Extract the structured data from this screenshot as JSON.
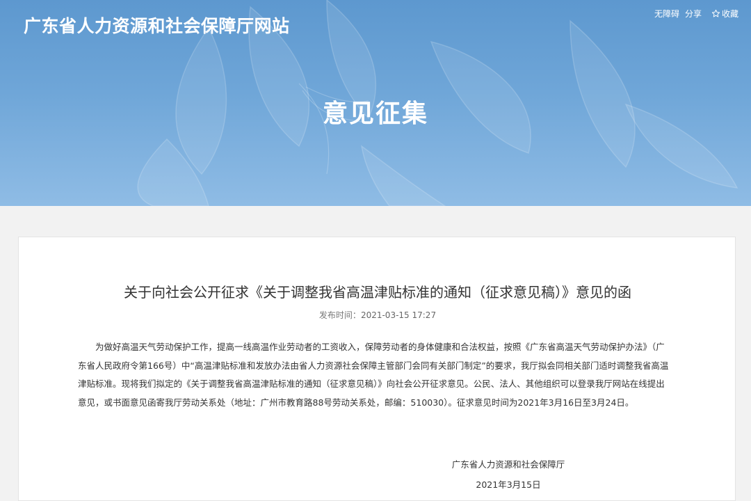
{
  "header": {
    "site_title": "广东省人力资源和社会保障厅网站",
    "toolbar": {
      "accessibility_label": "无障碍",
      "share_label": "分享",
      "favorite_label": "收藏"
    },
    "section_title": "意见征集"
  },
  "article": {
    "title": "关于向社会公开征求《关于调整我省高温津贴标准的通知（征求意见稿）》意见的函",
    "publish_label": "发布时间：",
    "publish_time": "2021-03-15 17:27",
    "body": "为做好高温天气劳动保护工作，提高一线高温作业劳动者的工资收入，保障劳动者的身体健康和合法权益，按照《广东省高温天气劳动保护办法》（广东省人民政府令第166号）中“高温津贴标准和发放办法由省人力资源社会保障主管部门会同有关部门制定”的要求，我厅拟会同相关部门适时调整我省高温津贴标准。现将我们拟定的《关于调整我省高温津贴标准的通知（征求意见稿）》向社会公开征求意见。公民、法人、其他组织可以登录我厅网站在线提出意见，或书面意见函寄我厅劳动关系处（地址：广州市教育路88号劳动关系处，邮编：510030）。征求意见时间为2021年3月16日至3月24日。",
    "signature_org": "广东省人力资源和社会保障厅",
    "signature_date": "2021年3月15日"
  },
  "colors": {
    "banner_top": "#5d98cf",
    "banner_bottom": "#8fbce5",
    "page_background": "#f2f2f2",
    "text": "#333333"
  },
  "icons": {
    "favorite": "star-outline-icon"
  }
}
